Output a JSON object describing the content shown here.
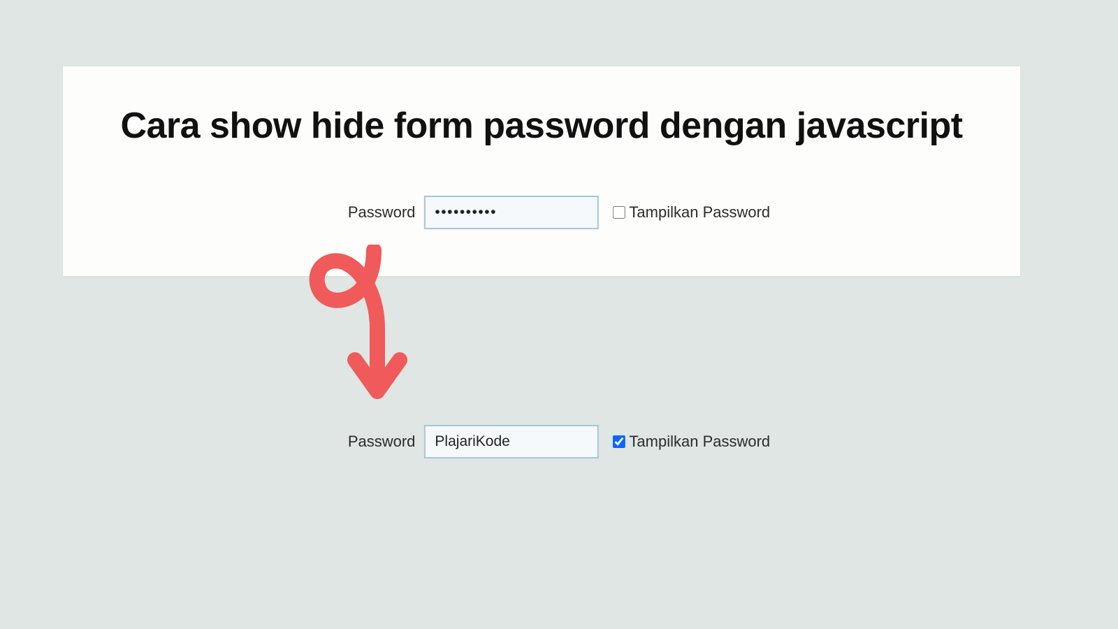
{
  "title": "Cara show hide form password dengan javascript",
  "rows": [
    {
      "label": "Password",
      "value": "••••••••••",
      "checkbox_label": "Tampilkan Password",
      "checked": false
    },
    {
      "label": "Password",
      "value": "PlajariKode",
      "checkbox_label": "Tampilkan Password",
      "checked": true
    }
  ],
  "annotation": {
    "color": "#f05a5a",
    "type": "curved-arrow-down"
  }
}
